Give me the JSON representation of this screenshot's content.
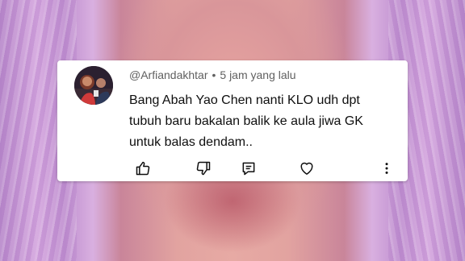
{
  "comment": {
    "username": "@Arfiandakhtar",
    "separator": "•",
    "timestamp": "5 jam yang lalu",
    "text_lines": [
      "Bang Abah Yao Chen nanti KLO udh dpt",
      "tubuh baru bakalan balik ke aula jiwa GK",
      "untuk balas dendam.."
    ]
  },
  "actions": {
    "like_icon": "thumbs-up-icon",
    "dislike_icon": "thumbs-down-icon",
    "reply_icon": "reply-comment-icon",
    "heart_icon": "heart-icon",
    "more_icon": "more-vertical-icon"
  }
}
